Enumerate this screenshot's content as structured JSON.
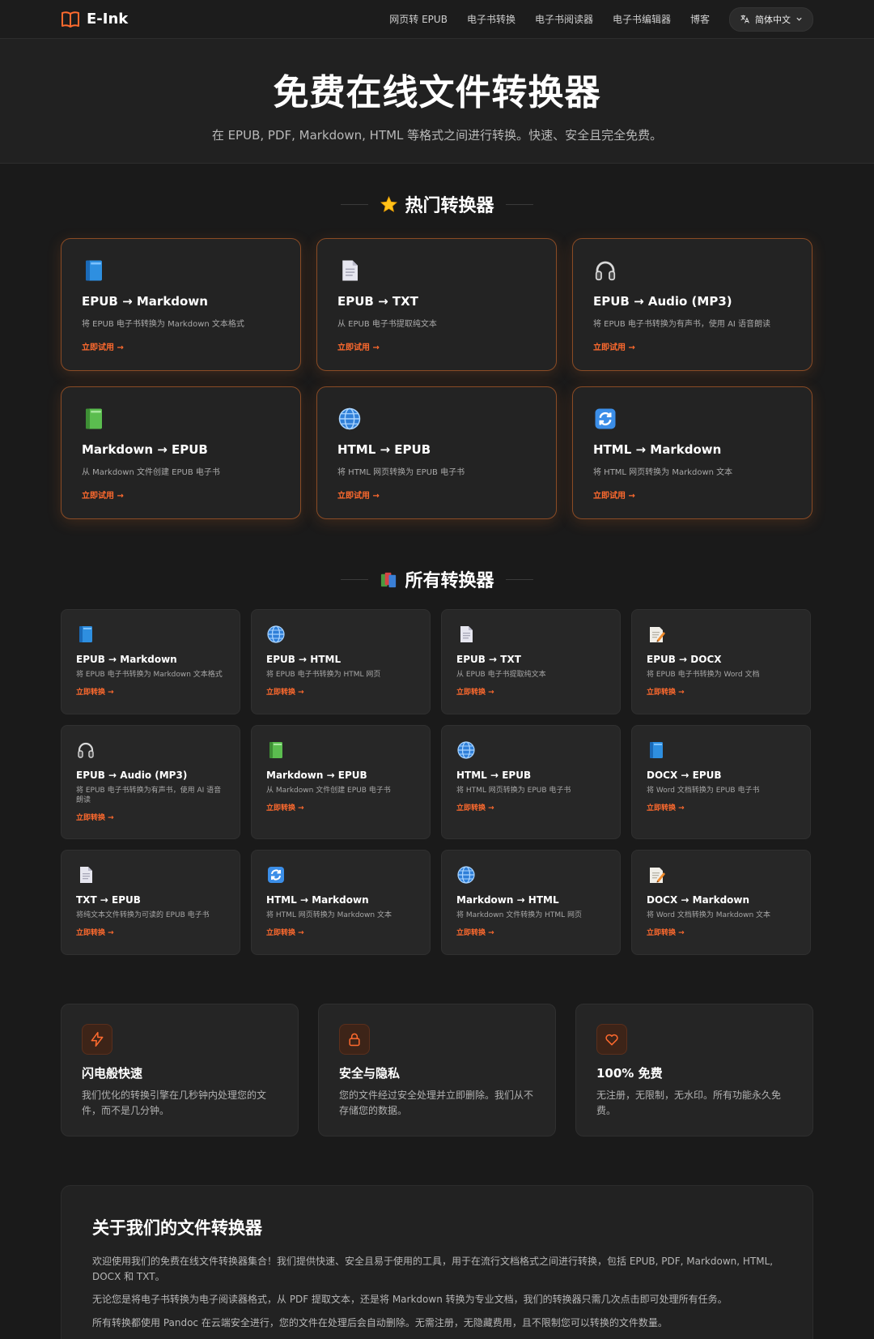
{
  "nav": {
    "logo_icon": "open-book-icon",
    "brand": "E-Ink",
    "links": [
      "网页转 EPUB",
      "电子书转换",
      "电子书阅读器",
      "电子书编辑器",
      "博客"
    ],
    "language": "简体中文",
    "language_icon": "translate-icon"
  },
  "hero": {
    "title": "免费在线文件转换器",
    "subtitle": "在 EPUB, PDF, Markdown, HTML 等格式之间进行转换。快速、安全且完全免费。"
  },
  "popular": {
    "icon": "star-icon",
    "heading": "热门转换器",
    "cta": "立即试用 →",
    "items": [
      {
        "icon": "blue-book-icon",
        "title": "EPUB → Markdown",
        "desc": "将 EPUB 电子书转换为 Markdown 文本格式"
      },
      {
        "icon": "document-icon",
        "title": "EPUB → TXT",
        "desc": "从 EPUB 电子书提取纯文本"
      },
      {
        "icon": "headphones-icon",
        "title": "EPUB → Audio (MP3)",
        "desc": "将 EPUB 电子书转换为有声书，使用 AI 语音朗读"
      },
      {
        "icon": "green-book-icon",
        "title": "Markdown → EPUB",
        "desc": "从 Markdown 文件创建 EPUB 电子书"
      },
      {
        "icon": "globe-icon",
        "title": "HTML → EPUB",
        "desc": "将 HTML 网页转换为 EPUB 电子书"
      },
      {
        "icon": "refresh-icon",
        "title": "HTML → Markdown",
        "desc": "将 HTML 网页转换为 Markdown 文本"
      }
    ]
  },
  "all": {
    "icon": "books-icon",
    "heading": "所有转换器",
    "cta": "立即转换 →",
    "items": [
      {
        "icon": "blue-book-icon",
        "title": "EPUB → Markdown",
        "desc": "将 EPUB 电子书转换为 Markdown 文本格式"
      },
      {
        "icon": "globe-icon",
        "title": "EPUB → HTML",
        "desc": "将 EPUB 电子书转换为 HTML 网页"
      },
      {
        "icon": "document-icon",
        "title": "EPUB → TXT",
        "desc": "从 EPUB 电子书提取纯文本"
      },
      {
        "icon": "memo-icon",
        "title": "EPUB → DOCX",
        "desc": "将 EPUB 电子书转换为 Word 文档"
      },
      {
        "icon": "headphones-icon",
        "title": "EPUB → Audio (MP3)",
        "desc": "将 EPUB 电子书转换为有声书，使用 AI 语音朗读"
      },
      {
        "icon": "green-book-icon",
        "title": "Markdown → EPUB",
        "desc": "从 Markdown 文件创建 EPUB 电子书"
      },
      {
        "icon": "globe-icon",
        "title": "HTML → EPUB",
        "desc": "将 HTML 网页转换为 EPUB 电子书"
      },
      {
        "icon": "blue-book-icon",
        "title": "DOCX → EPUB",
        "desc": "将 Word 文档转换为 EPUB 电子书"
      },
      {
        "icon": "document-icon",
        "title": "TXT → EPUB",
        "desc": "将纯文本文件转换为可读的 EPUB 电子书"
      },
      {
        "icon": "refresh-icon",
        "title": "HTML → Markdown",
        "desc": "将 HTML 网页转换为 Markdown 文本"
      },
      {
        "icon": "globe-icon",
        "title": "Markdown → HTML",
        "desc": "将 Markdown 文件转换为 HTML 网页"
      },
      {
        "icon": "memo-icon",
        "title": "DOCX → Markdown",
        "desc": "将 Word 文档转换为 Markdown 文本"
      }
    ]
  },
  "features": [
    {
      "icon": "lightning-icon",
      "title": "闪电般快速",
      "desc": "我们优化的转换引擎在几秒钟内处理您的文件，而不是几分钟。"
    },
    {
      "icon": "lock-icon",
      "title": "安全与隐私",
      "desc": "您的文件经过安全处理并立即删除。我们从不存储您的数据。"
    },
    {
      "icon": "heart-icon",
      "title": "100% 免费",
      "desc": "无注册，无限制，无水印。所有功能永久免费。"
    }
  ],
  "about": {
    "title": "关于我们的文件转换器",
    "paragraphs": [
      "欢迎使用我们的免费在线文件转换器集合！我们提供快速、安全且易于使用的工具，用于在流行文档格式之间进行转换，包括 EPUB, PDF, Markdown, HTML, DOCX 和 TXT。",
      "无论您是将电子书转换为电子阅读器格式，从 PDF 提取文本，还是将 Markdown 转换为专业文档，我们的转换器只需几次点击即可处理所有任务。",
      "所有转换都使用 Pandoc 在云端安全进行，您的文件在处理后会自动删除。无需注册，无隐藏费用，且不限制您可以转换的文件数量。"
    ]
  },
  "colors": {
    "accent": "#ff6a2e",
    "background": "#1a1a1a",
    "card": "#232323"
  }
}
